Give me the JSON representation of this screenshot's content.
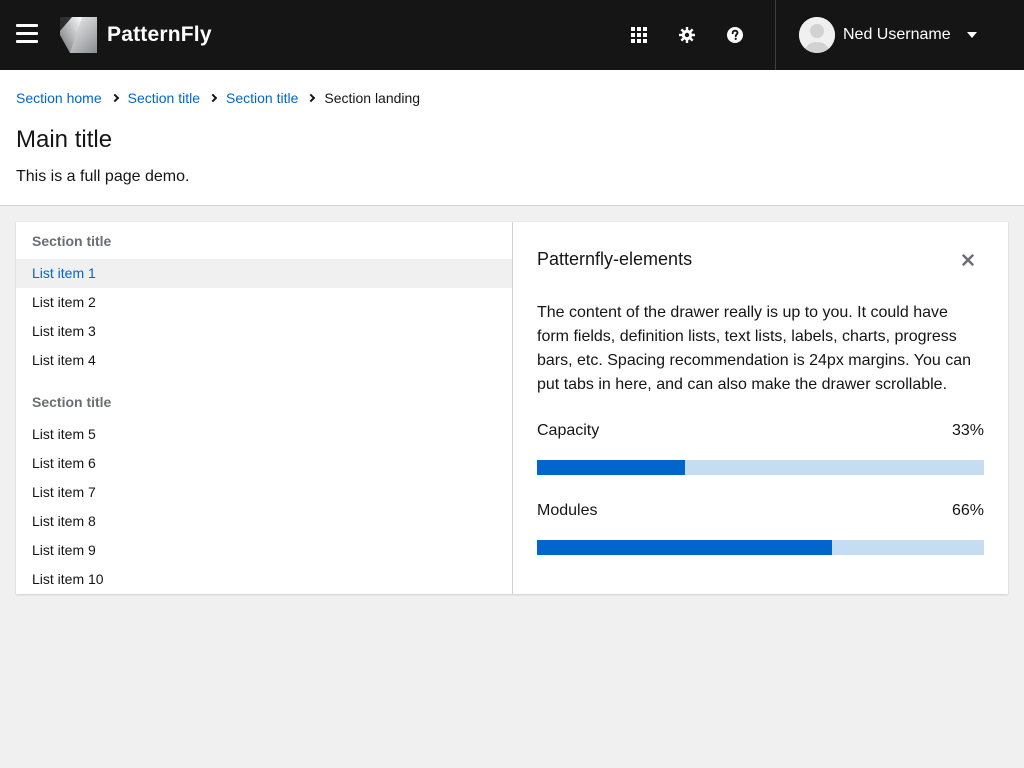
{
  "header": {
    "logo_text": "PatternFly",
    "user_name": "Ned Username",
    "icons": [
      "apps-grid-icon",
      "gear-icon",
      "help-icon",
      "caret-down-icon",
      "hamburger-icon"
    ]
  },
  "breadcrumb": {
    "items": [
      "Section home",
      "Section title",
      "Section title"
    ],
    "current": "Section landing"
  },
  "page": {
    "title": "Main title",
    "description": "This is a full page demo."
  },
  "nav": {
    "sections": [
      {
        "title": "Section title",
        "items": [
          "List item 1",
          "List item 2",
          "List item 3",
          "List item 4"
        ]
      },
      {
        "title": "Section title",
        "items": [
          "List item 5",
          "List item 6",
          "List item 7",
          "List item 8",
          "List item 9",
          "List item 10"
        ]
      }
    ],
    "active_item": "List item 1"
  },
  "drawer": {
    "title": "Patternfly-elements",
    "body": "The content of the drawer really is up to you. It could have form fields, definition lists, text lists, labels, charts, progress bars, etc. Spacing recommendation is 24px margins. You can put tabs in here, and can also make the drawer scrollable.",
    "progress": [
      {
        "label": "Capacity",
        "value_text": "33%",
        "fraction": 0.33
      },
      {
        "label": "Modules",
        "value_text": "66%",
        "fraction": 0.66
      }
    ]
  },
  "colors": {
    "masthead": "#151515",
    "link": "#0066cc",
    "progress_fill": "#0066cc",
    "progress_track": "#c6dcf2",
    "page_bg": "#f0f0f0"
  }
}
